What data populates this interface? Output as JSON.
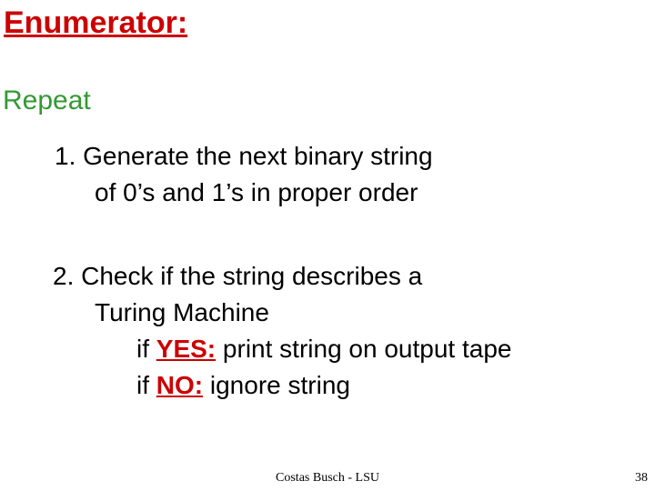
{
  "title": "Enumerator:",
  "repeat": "Repeat",
  "item1": {
    "line1": "1.  Generate the next binary string",
    "line2": "of 0’s and 1’s in proper order"
  },
  "item2": {
    "line1": "2.  Check if the string describes a",
    "line2": "Turing Machine",
    "yes_prefix": "if ",
    "yes_kw": "YES:",
    "yes_suffix": " print string on output tape",
    "no_prefix": "if ",
    "no_kw": "NO:",
    "no_suffix": "  ignore string"
  },
  "footer": {
    "author": "Costas Busch - LSU",
    "page": "38"
  }
}
